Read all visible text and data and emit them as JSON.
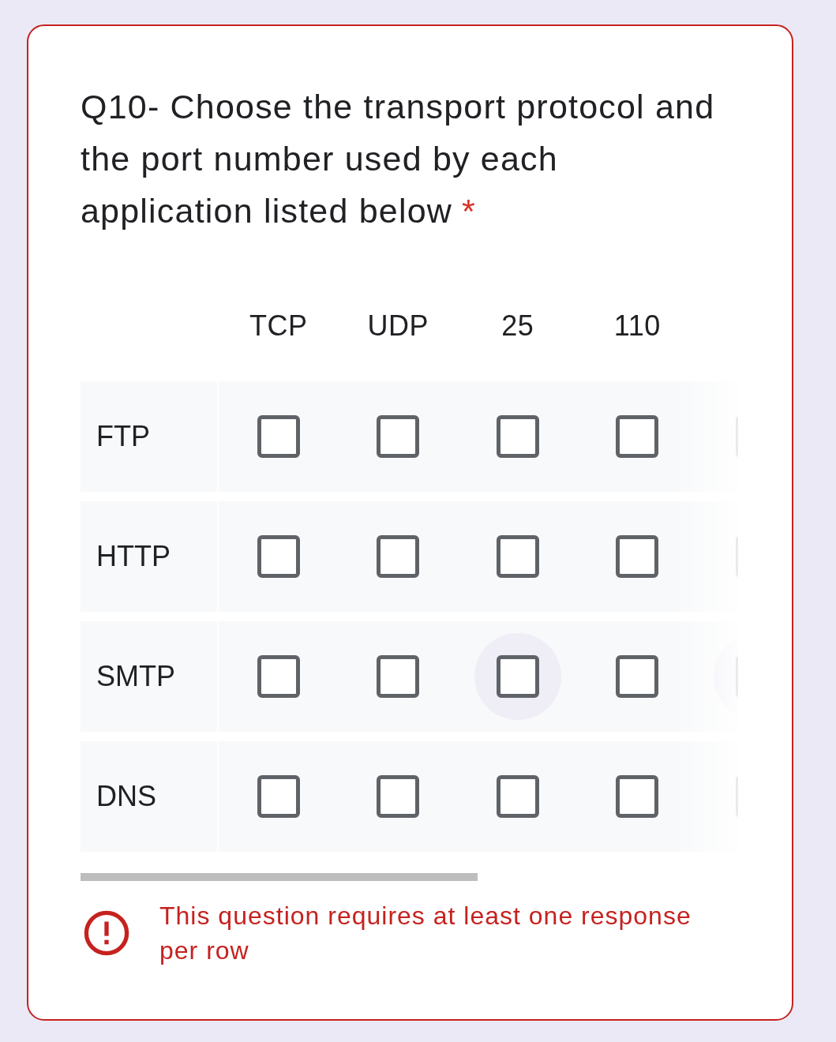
{
  "question": {
    "title": "Q10- Choose the transport protocol and the port number used by each application listed below",
    "required_mark": "*"
  },
  "grid": {
    "columns": [
      "TCP",
      "UDP",
      "25",
      "110"
    ],
    "rows": [
      {
        "label": "FTP",
        "cells": [
          {
            "checked": false,
            "focused": false
          },
          {
            "checked": false,
            "focused": false
          },
          {
            "checked": false,
            "focused": false
          },
          {
            "checked": false,
            "focused": false
          },
          {
            "checked": false,
            "focused": false
          }
        ]
      },
      {
        "label": "HTTP",
        "cells": [
          {
            "checked": false,
            "focused": false
          },
          {
            "checked": false,
            "focused": false
          },
          {
            "checked": false,
            "focused": false
          },
          {
            "checked": false,
            "focused": false
          },
          {
            "checked": false,
            "focused": false
          }
        ]
      },
      {
        "label": "SMTP",
        "cells": [
          {
            "checked": false,
            "focused": false
          },
          {
            "checked": false,
            "focused": false
          },
          {
            "checked": false,
            "focused": true
          },
          {
            "checked": false,
            "focused": false
          },
          {
            "checked": false,
            "focused": true
          }
        ]
      },
      {
        "label": "DNS",
        "cells": [
          {
            "checked": false,
            "focused": false
          },
          {
            "checked": false,
            "focused": false
          },
          {
            "checked": false,
            "focused": false
          },
          {
            "checked": false,
            "focused": false
          },
          {
            "checked": false,
            "focused": false
          }
        ]
      }
    ]
  },
  "error": {
    "message": "This question requires at least one response per row"
  }
}
